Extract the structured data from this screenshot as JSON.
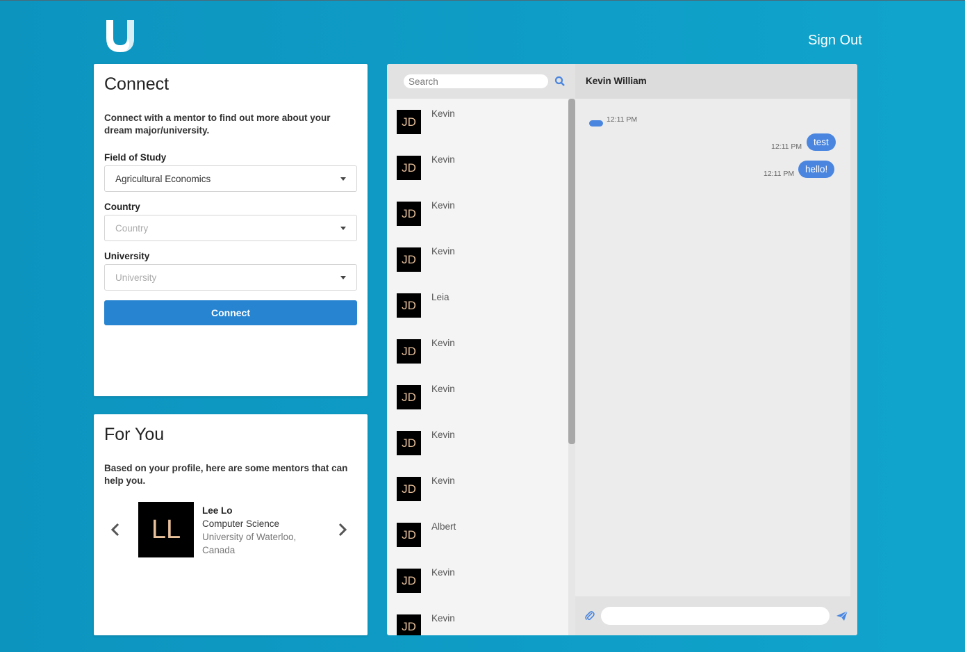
{
  "header": {
    "logo_icon": "logo-u-icon",
    "signout_label": "Sign Out"
  },
  "connect": {
    "title": "Connect",
    "description": "Connect with a mentor to find out more about your dream major/university.",
    "field_label": "Field of Study",
    "field_value": "Agricultural Economics",
    "country_label": "Country",
    "country_placeholder": "Country",
    "university_label": "University",
    "university_placeholder": "University",
    "button_label": "Connect"
  },
  "foryou": {
    "title": "For You",
    "description": "Based on your profile, here are some mentors that can help you.",
    "mentor": {
      "initials": "LL",
      "name": "Lee Lo",
      "field": "Computer Science",
      "school": "University of Waterloo, Canada"
    }
  },
  "chat": {
    "search_placeholder": "Search",
    "contacts": [
      {
        "initials": "JD",
        "name": "Kevin"
      },
      {
        "initials": "JD",
        "name": "Kevin"
      },
      {
        "initials": "JD",
        "name": "Kevin"
      },
      {
        "initials": "JD",
        "name": "Kevin"
      },
      {
        "initials": "JD",
        "name": "Leia"
      },
      {
        "initials": "JD",
        "name": "Kevin"
      },
      {
        "initials": "JD",
        "name": "Kevin"
      },
      {
        "initials": "JD",
        "name": "Kevin"
      },
      {
        "initials": "JD",
        "name": "Kevin"
      },
      {
        "initials": "JD",
        "name": "Albert"
      },
      {
        "initials": "JD",
        "name": "Kevin"
      },
      {
        "initials": "JD",
        "name": "Kevin"
      }
    ],
    "conversation_title": "Kevin William",
    "messages": [
      {
        "side": "received",
        "text": "",
        "time": "12:11 PM"
      },
      {
        "side": "sent",
        "text": "test",
        "time": "12:11 PM"
      },
      {
        "side": "sent",
        "text": "hello!",
        "time": "12:11 PM"
      }
    ],
    "message_placeholder": ""
  },
  "colors": {
    "accent": "#2784d0",
    "bubble": "#4a86e0",
    "background": "#0c94bf",
    "avatar_text": "#e8c09a"
  }
}
